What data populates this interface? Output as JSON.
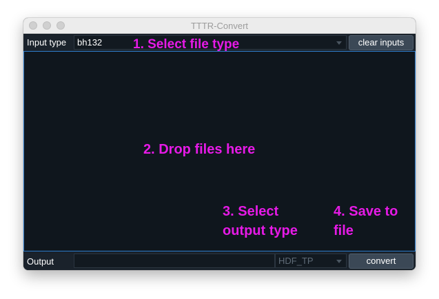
{
  "window": {
    "title": "TTTR-Convert"
  },
  "input": {
    "label": "Input type",
    "selected_type": "bh132",
    "clear_button": "clear inputs"
  },
  "annotations": {
    "step1": "1. Select file type",
    "step2": "2. Drop files here",
    "step3_line1": "3. Select",
    "step3_line2": "output type",
    "step4_line1": "4. Save to",
    "step4_line2": "file"
  },
  "output": {
    "label": "Output",
    "path_value": "",
    "selected_type": "HDF_TP",
    "convert_button": "convert"
  },
  "colors": {
    "annotation": "#e61ae6",
    "background": "#0f161d",
    "accent_border": "#2f7fd0"
  }
}
